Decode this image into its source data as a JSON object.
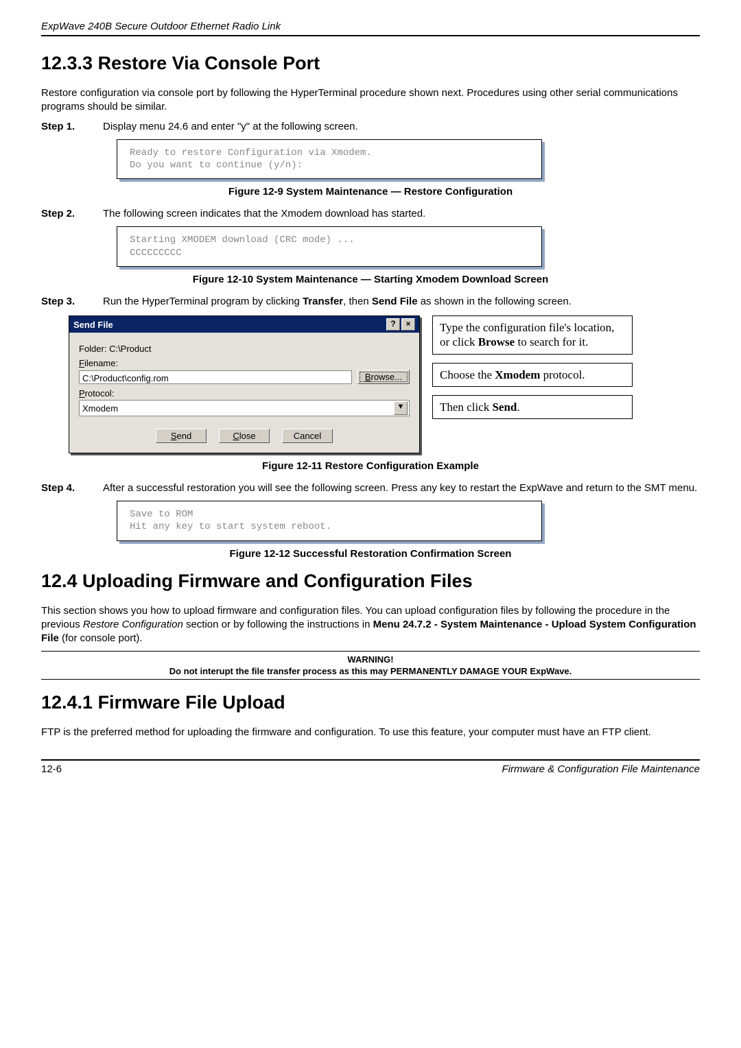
{
  "header": "ExpWave 240B Secure Outdoor Ethernet Radio Link",
  "section_12_3_3_title": "12.3.3 Restore Via Console Port",
  "intro_1": "Restore configuration via console port by following the HyperTerminal procedure shown next. Procedures using other serial communications programs should be similar.",
  "step1_label": "Step 1.",
  "step1_text": "Display menu 24.6 and enter \"y\" at the following screen.",
  "box1_line1": "Ready to restore Configuration via Xmodem.",
  "box1_line2": "Do you want to continue (y/n):",
  "caption_12_9": "Figure 12-9 System Maintenance — Restore Configuration",
  "step2_label": "Step 2.",
  "step2_text": "The following screen indicates that the Xmodem download has started.",
  "box2_line1": "Starting XMODEM download (CRC mode) ...",
  "box2_line2": "CCCCCCCCC",
  "caption_12_10": "Figure 12-10 System Maintenance — Starting Xmodem Download Screen",
  "step3_label": "Step 3.",
  "step3_text_a": "Run the HyperTerminal program by clicking ",
  "step3_bold_a": "Transfer",
  "step3_text_b": ", then ",
  "step3_bold_b": "Send File",
  "step3_text_c": " as shown in the following screen.",
  "dialog": {
    "title": "Send File",
    "help_btn": "?",
    "close_btn": "×",
    "folder_label": "Folder: C:\\Product",
    "filename_label": "Filename:",
    "filename_value": "C:\\Product\\config.rom",
    "browse_btn": "Browse...",
    "protocol_label": "Protocol:",
    "protocol_value": "Xmodem",
    "send_btn": "Send",
    "close_btn2": "Close",
    "cancel_btn": "Cancel"
  },
  "callout1_a": "Type the configuration file's location, or click ",
  "callout1_bold": "Browse",
  "callout1_b": " to search for it.",
  "callout2_a": "Choose the ",
  "callout2_bold": "Xmodem",
  "callout2_b": " protocol.",
  "callout3_a": "Then click ",
  "callout3_bold": "Send",
  "callout3_b": ".",
  "caption_12_11": "Figure 12-11 Restore Configuration Example",
  "step4_label": "Step 4.",
  "step4_text": "After a successful restoration you will see the following screen. Press any key to restart the ExpWave and return to the SMT menu.",
  "box3_line1": "Save to ROM",
  "box3_line2": "Hit any key to start system reboot.",
  "caption_12_12": "Figure 12-12 Successful Restoration Confirmation Screen",
  "section_12_4_title": "12.4   Uploading Firmware and Configuration Files",
  "para_12_4_a": "This section shows you how to upload firmware and configuration files. You can upload configuration files by following the procedure in the previous ",
  "para_12_4_italic": "Restore Configuration",
  "para_12_4_b": " section or by following the instructions in ",
  "para_12_4_bold": "Menu 24.7.2 - System Maintenance - Upload System Configuration File",
  "para_12_4_c": " (for console port).",
  "warning_title": "WARNING!",
  "warning_text": "Do not interupt the file transfer process as this may PERMANENTLY DAMAGE YOUR ExpWave.",
  "section_12_4_1_title": "12.4.1 Firmware File Upload",
  "para_12_4_1": "FTP is the preferred method for uploading the firmware and configuration. To use this feature, your computer must have an FTP client.",
  "footer_left": "12-6",
  "footer_right": "Firmware & Configuration File Maintenance"
}
